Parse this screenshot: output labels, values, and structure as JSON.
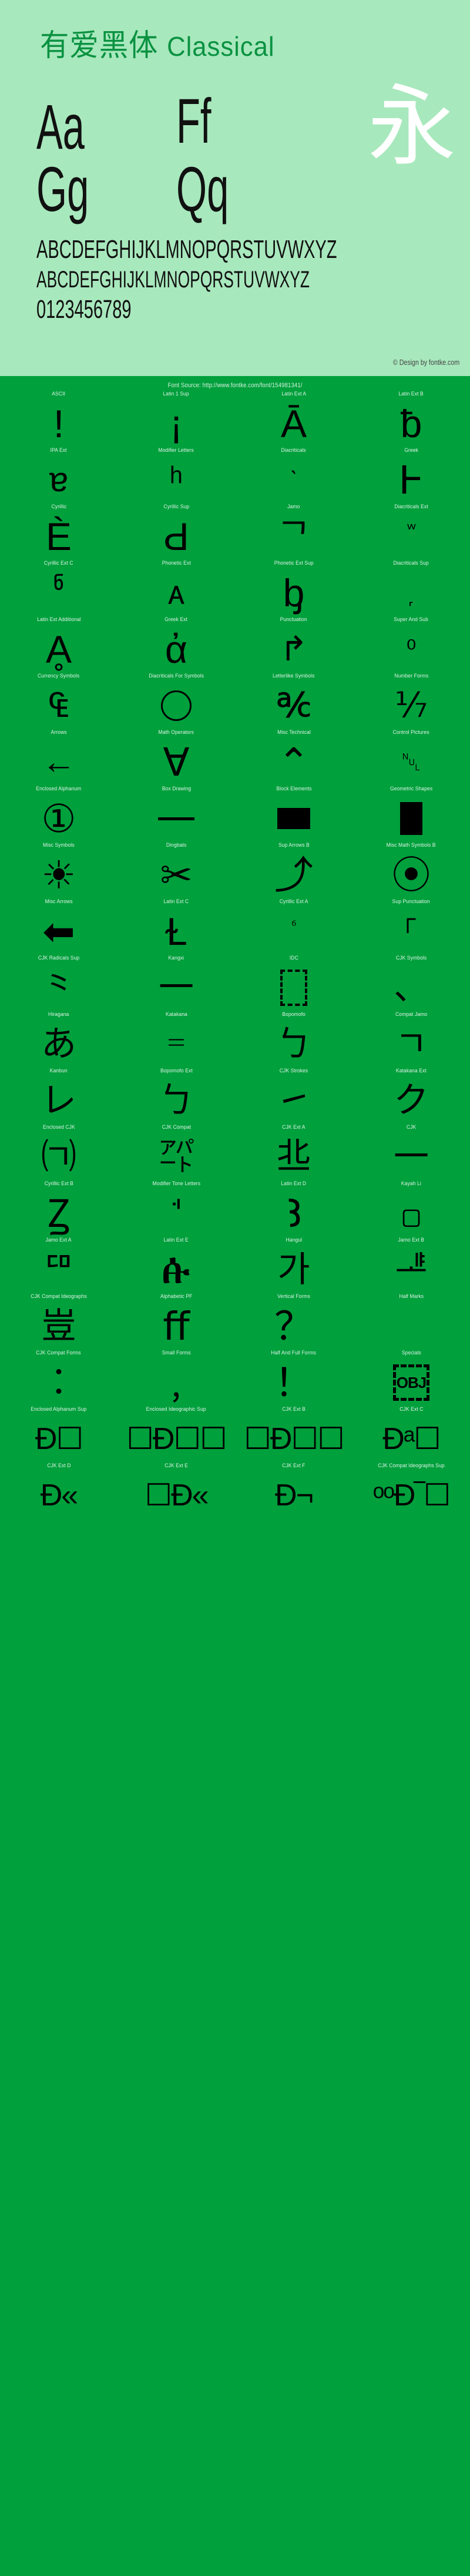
{
  "hero": {
    "title_cjk": "有爱黑体",
    "title_latin": "Classical",
    "samples": [
      {
        "name": "sample-A",
        "text": "Aa"
      },
      {
        "name": "sample-F",
        "text": "Ff"
      },
      {
        "name": "sample-G",
        "text": "Gg"
      },
      {
        "name": "sample-Q",
        "text": "Qq"
      },
      {
        "name": "sample-yong",
        "text": "永"
      }
    ],
    "uppercase": "ABCDEFGHIJKLMNOPQRSTUVWXYZ",
    "lowercase": "ABCDEFGHIJKLMNOPQRSTUVWXYZ",
    "digits": "0123456789",
    "copyright": "© Design by fontke.com",
    "bg_color": "#a8e8bd",
    "title_color": "#0a9241"
  },
  "source": {
    "text": "Font Source: http://www.fontke.com/font/154981341/"
  },
  "grid": {
    "bg_color": "#00a03c",
    "label_color": "#dff3e6",
    "rows": [
      [
        {
          "label": "ASCII",
          "glyph": "!",
          "size": "tall"
        },
        {
          "label": "Latin 1 Sup",
          "glyph": "¡",
          "size": "tall"
        },
        {
          "label": "Latin Ext A",
          "glyph": "Ā",
          "size": "tall"
        },
        {
          "label": "Latin Ext B",
          "glyph": "ƀ",
          "size": "tall"
        }
      ],
      [
        {
          "label": "IPA Ext",
          "glyph": "ɐ",
          "size": ""
        },
        {
          "label": "Modifier Letters",
          "glyph": "ʰ",
          "size": ""
        },
        {
          "label": "Diacriticals",
          "glyph": "ˋ",
          "size": "small"
        },
        {
          "label": "Greek",
          "glyph": "Ͱ",
          "size": "tall"
        }
      ],
      [
        {
          "label": "Cyrillic",
          "glyph": "Ѐ",
          "size": "tall"
        },
        {
          "label": "Cyrillic Sup",
          "glyph": "Ԁ",
          "size": "tall"
        },
        {
          "label": "Jamo",
          "glyph": "ᄀ",
          "size": "cjk"
        },
        {
          "label": "Diacriticals Ext",
          "glyph": "ᷱ",
          "size": "small"
        }
      ],
      [
        {
          "label": "Cyrillic Ext C",
          "glyph": "ჼ",
          "size": "tall"
        },
        {
          "label": "Phonetic Ext",
          "glyph": "ᴀ",
          "size": ""
        },
        {
          "label": "Phonetic Ext Sup",
          "glyph": "ᶀ",
          "size": "tall"
        },
        {
          "label": "Diacriticals Sup",
          "glyph": "᷊",
          "size": "small"
        }
      ],
      [
        {
          "label": "Latin Ext Additional",
          "glyph": "Ḁ",
          "size": "tall"
        },
        {
          "label": "Greek Ext",
          "glyph": "ἀ",
          "size": "tall"
        },
        {
          "label": "Punctuation",
          "glyph": "↱",
          "size": ""
        },
        {
          "label": "Super And Sub",
          "glyph": "⁰",
          "size": "small"
        }
      ],
      [
        {
          "label": "Currency Symbols",
          "glyph": "₠",
          "size": ""
        },
        {
          "label": "Diacriticals For Symbols",
          "glyph": "shape-circle",
          "size": ""
        },
        {
          "label": "Letterlike Symbols",
          "glyph": "℀",
          "size": ""
        },
        {
          "label": "Number Forms",
          "glyph": "⅐",
          "size": ""
        }
      ],
      [
        {
          "label": "Arrows",
          "glyph": "←",
          "size": ""
        },
        {
          "label": "Math Operators",
          "glyph": "∀",
          "size": "tall"
        },
        {
          "label": "Misc Technical",
          "glyph": "⌃",
          "size": "tall"
        },
        {
          "label": "Control Pictures",
          "glyph": "␀",
          "size": "small"
        }
      ],
      [
        {
          "label": "Enclosed Alphanum",
          "glyph": "①",
          "size": "tall"
        },
        {
          "label": "Box Drawing",
          "glyph": "shape-hline",
          "size": ""
        },
        {
          "label": "Block Elements",
          "glyph": "shape-block",
          "size": ""
        },
        {
          "label": "Geometric Shapes",
          "glyph": "shape-geo",
          "size": ""
        }
      ],
      [
        {
          "label": "Misc Symbols",
          "glyph": "☀",
          "size": "tall"
        },
        {
          "label": "Dingbats",
          "glyph": "✂",
          "size": "tall"
        },
        {
          "label": "Sup Arrows B",
          "glyph": "⤴",
          "size": "tall"
        },
        {
          "label": "Misc Math Symbols B",
          "glyph": "⦿",
          "size": "tall"
        }
      ],
      [
        {
          "label": "Misc Arrows",
          "glyph": "⬅",
          "size": "tall"
        },
        {
          "label": "Latin Ext C",
          "glyph": "Ɫ",
          "size": "tall"
        },
        {
          "label": "Cyrillic Ext A",
          "glyph": "ⷠ",
          "size": "tiny"
        },
        {
          "label": "Sup Punctuation",
          "glyph": "⸀",
          "size": ""
        }
      ],
      [
        {
          "label": "CJK Radicals Sup",
          "glyph": "⺀",
          "size": "cjk"
        },
        {
          "label": "Kangxi",
          "glyph": "⼀",
          "size": "cjk"
        },
        {
          "label": "IDC",
          "glyph": "shape-dashbox",
          "size": ""
        },
        {
          "label": "CJK Symbols",
          "glyph": "、",
          "size": "cjk"
        }
      ],
      [
        {
          "label": "Hiragana",
          "glyph": "あ",
          "size": "cjk"
        },
        {
          "label": "Katakana",
          "glyph": "゠",
          "size": "cjk"
        },
        {
          "label": "Bopomofo",
          "glyph": "ㄅ",
          "size": "cjk"
        },
        {
          "label": "Compat Jamo",
          "glyph": "ㄱ",
          "size": "cjk"
        }
      ],
      [
        {
          "label": "Kanbun",
          "glyph": "レ",
          "size": "cjk"
        },
        {
          "label": "Bopomofo Ext",
          "glyph": "ㄅ",
          "size": "cjk"
        },
        {
          "label": "CJK Strokes",
          "glyph": "㇀",
          "size": "cjk"
        },
        {
          "label": "Katakana Ext",
          "glyph": "ク",
          "size": "cjk"
        }
      ],
      [
        {
          "label": "Enclosed CJK",
          "glyph": "㈀",
          "size": "cjk"
        },
        {
          "label": "CJK Compat",
          "glyph": "㌀",
          "size": "cjk"
        },
        {
          "label": "CJK Ext A",
          "glyph": "丠",
          "size": "cjk"
        },
        {
          "label": "CJK",
          "glyph": "一",
          "size": "cjk"
        }
      ],
      [
        {
          "label": "Cyrillic Ext B",
          "glyph": "Ꙁ",
          "size": "tall"
        },
        {
          "label": "Modifier Tone Letters",
          "glyph": "ꜗ",
          "size": "tall"
        },
        {
          "label": "Latin Ext D",
          "glyph": "Ꜣ",
          "size": "tall"
        },
        {
          "label": "Kayah Li",
          "glyph": "꤀",
          "size": "tall"
        }
      ],
      [
        {
          "label": "Jamo Ext A",
          "glyph": "ꥠ",
          "size": "cjk"
        },
        {
          "label": "Latin Ext E",
          "glyph": "ꬁ",
          "size": "tall"
        },
        {
          "label": "Hangul",
          "glyph": "가",
          "size": "cjk"
        },
        {
          "label": "Jamo Ext B",
          "glyph": "ힽ",
          "size": "cjk"
        }
      ],
      [
        {
          "label": "CJK Compat Ideographs",
          "glyph": "豈",
          "size": "cjk"
        },
        {
          "label": "Alphabetic PF",
          "glyph": "ﬀ",
          "size": "tall"
        },
        {
          "label": "Vertical Forms",
          "glyph": "？",
          "size": "tall"
        },
        {
          "label": "Half Marks",
          "glyph": "﾿",
          "size": "tall"
        }
      ],
      [
        {
          "label": "CJK Compat Forms",
          "glyph": "︰",
          "size": "tall"
        },
        {
          "label": "Small Forms",
          "glyph": "﹐",
          "size": "tall"
        },
        {
          "label": "Half And Full Forms",
          "glyph": "！",
          "size": "tall"
        },
        {
          "label": "Specials",
          "glyph": "shape-obj",
          "size": ""
        }
      ],
      [
        {
          "label": "Enclosed Alphanum Sup",
          "glyph": "Ð☐",
          "size": "wide"
        },
        {
          "label": "Enclosed Ideographic Sup",
          "glyph": "☐Ð☐☐",
          "size": "wide"
        },
        {
          "label": "CJK Ext B",
          "glyph": "☐Ð☐☐",
          "size": "wide"
        },
        {
          "label": "CJK Ext C",
          "glyph": "Ðᵃ☐",
          "size": "wide"
        }
      ],
      [
        {
          "label": "CJK Ext D",
          "glyph": "Ð«",
          "size": "wide"
        },
        {
          "label": "CJK Ext E",
          "glyph": "☐Ð«",
          "size": "wide"
        },
        {
          "label": "CJK Ext F",
          "glyph": "Ð¬",
          "size": "wide"
        },
        {
          "label": "CJK Compat Ideographs Sup",
          "glyph": "ᵒᵒÐ‾☐",
          "size": "wide"
        }
      ]
    ]
  }
}
